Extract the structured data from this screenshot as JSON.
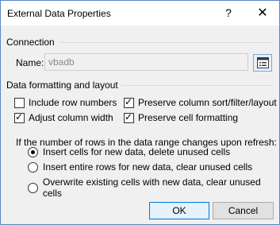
{
  "window": {
    "title": "External Data Properties",
    "help_glyph": "?",
    "close_glyph": "✕"
  },
  "connection": {
    "section_label": "Connection",
    "name_label": "Name:",
    "name_value": "vbadb",
    "props_icon": "connection-properties-icon"
  },
  "formatting": {
    "section_label": "Data formatting and layout",
    "include_row_numbers": {
      "label": "Include row numbers",
      "checked": false
    },
    "adjust_column_width": {
      "label": "Adjust column width",
      "checked": true
    },
    "preserve_sort": {
      "label": "Preserve column sort/filter/layout",
      "checked": true
    },
    "preserve_formatting": {
      "label": "Preserve cell formatting",
      "checked": true
    }
  },
  "refresh": {
    "prompt": "If the number of rows in the data range changes upon refresh:",
    "options": [
      {
        "label": "Insert cells for new data, delete unused cells",
        "selected": true
      },
      {
        "label": "Insert entire rows for new data, clear unused cells",
        "selected": false
      },
      {
        "label": "Overwrite existing cells with new data, clear unused cells",
        "selected": false
      }
    ]
  },
  "buttons": {
    "ok": "OK",
    "cancel": "Cancel"
  }
}
